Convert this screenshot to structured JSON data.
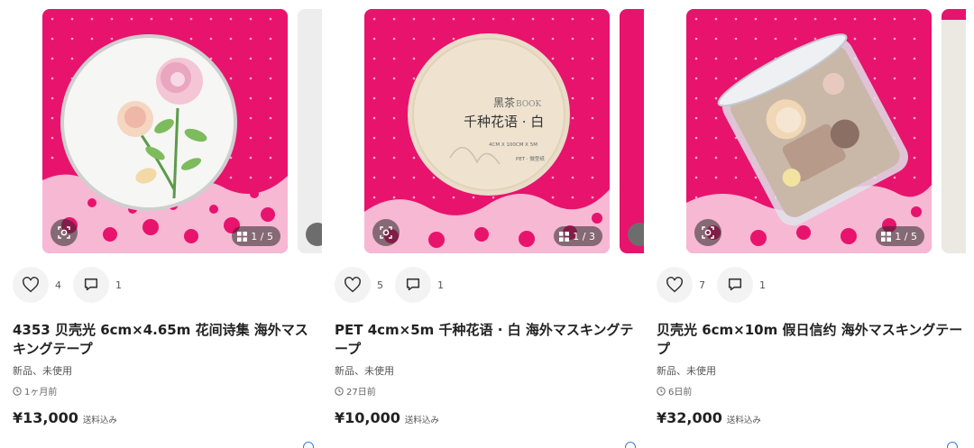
{
  "products": [
    {
      "title": "4353 贝壳光 6cm×4.65m 花间诗集 海外マスキングテープ",
      "condition": "新品、未使用",
      "time": "1ヶ月前",
      "price": "¥13,000",
      "shipping": "送料込み",
      "likes": "4",
      "comments": "1",
      "image_count": "1 / 5"
    },
    {
      "title": "PET 4cm×5m 千种花语 · 白 海外マスキングテープ",
      "condition": "新品、未使用",
      "time": "27日前",
      "price": "¥10,000",
      "shipping": "送料込み",
      "likes": "5",
      "comments": "1",
      "image_count": "1 / 3",
      "image_text": {
        "brand": "黑茶",
        "brand_suffix": "BOOK",
        "name": "千种花语 · 白",
        "spec": "4CM X 100CM X 5M",
        "material": "PET · 微型纸"
      }
    },
    {
      "title": "贝壳光 6cm×10m 假日信约 海外マスキングテープ",
      "condition": "新品、未使用",
      "time": "6日前",
      "price": "¥32,000",
      "shipping": "送料込み",
      "likes": "7",
      "comments": "1",
      "image_count": "1 / 5"
    }
  ],
  "colors": {
    "pink_background": "#e8136d",
    "accent_blue": "#3a7bd5"
  },
  "icons": [
    "heart-icon",
    "comment-icon",
    "lens-search-icon",
    "gallery-grid-icon",
    "clock-icon"
  ]
}
